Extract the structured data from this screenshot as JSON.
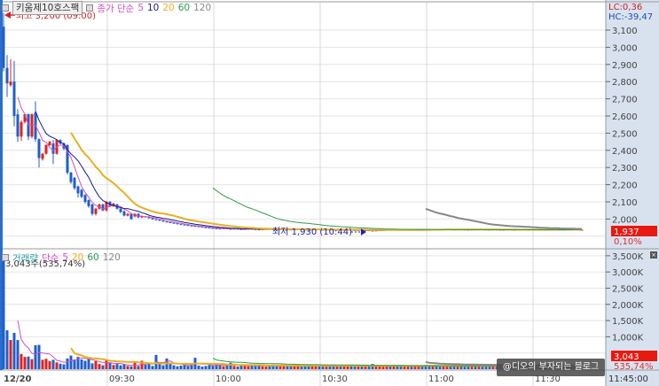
{
  "price_panel": {
    "title": "키움제10호스팩",
    "legend_prefix": "종가 단순",
    "ma_labels": [
      "5",
      "10",
      "20",
      "60",
      "120"
    ],
    "ma_colors": [
      "#d050c0",
      "#1a1a80",
      "#e8b020",
      "#2c9a4c",
      "#888888"
    ],
    "lc": "LC:0,36",
    "hc": "HC:-39,47",
    "high_note": "최고 3,200 (09:00)",
    "low_note": "최저 1,930 (10:44)",
    "last_price": "1,937",
    "last_change": "0,10%",
    "y_ticks": [
      "3,100",
      "3,000",
      "2,900",
      "2,800",
      "2,700",
      "2,600",
      "2,500",
      "2,400",
      "2,300",
      "2,200",
      "2,100",
      "2,000"
    ],
    "y_tick_values": [
      3100,
      3000,
      2900,
      2800,
      2700,
      2600,
      2500,
      2400,
      2300,
      2200,
      2100,
      2000
    ]
  },
  "volume_panel": {
    "title": "거래량",
    "legend_prefix": "단순",
    "ma_labels": [
      "5",
      "20",
      "60",
      "120"
    ],
    "ma_colors": [
      "#d050c0",
      "#e8b020",
      "#2c9a4c",
      "#888888"
    ],
    "current": "3,043주(535,74%)",
    "last_volume": "3,043",
    "last_change": "535,74%",
    "y_ticks": [
      "3,500K",
      "3,000K",
      "2,500K",
      "2,000K",
      "1,500K",
      "1,000K"
    ],
    "y_tick_values": [
      3500,
      3000,
      2500,
      2000,
      1500,
      1000
    ]
  },
  "time_axis": {
    "labels": [
      "12/20",
      "09:30",
      "10:00",
      "10:30",
      "11:00",
      "11:30"
    ],
    "label_bars": [
      0,
      30,
      60,
      90,
      120,
      150
    ],
    "current_time": "11:45:00"
  },
  "colors": {
    "up": "#e0211f",
    "down": "#1f5fc8",
    "axis_bg": "#d8e2ef",
    "last_box": "#e8190f"
  },
  "watermark": "@디오의 부자되는 블로그",
  "chart_data": {
    "type": "candlestick",
    "interval": "1 minute",
    "start_time": "09:00",
    "price_ylim": [
      1900,
      3200
    ],
    "volume_unit": "K shares",
    "volume_ylim": [
      0,
      3700
    ],
    "candles_ohlc": [
      [
        3120,
        3200,
        2860,
        2880
      ],
      [
        2880,
        2955,
        2710,
        2790
      ],
      [
        2780,
        2930,
        2770,
        2800
      ],
      [
        2800,
        2920,
        2540,
        2600
      ],
      [
        2610,
        2640,
        2450,
        2480
      ],
      [
        2480,
        2575,
        2455,
        2565
      ],
      [
        2565,
        2615,
        2555,
        2610
      ],
      [
        2610,
        2615,
        2460,
        2480
      ],
      [
        2480,
        2615,
        2470,
        2610
      ],
      [
        2620,
        2685,
        2450,
        2465
      ],
      [
        2465,
        2470,
        2300,
        2355
      ],
      [
        2350,
        2385,
        2340,
        2380
      ],
      [
        2380,
        2435,
        2375,
        2430
      ],
      [
        2430,
        2455,
        2425,
        2450
      ],
      [
        2440,
        2460,
        2320,
        2380
      ],
      [
        2380,
        2465,
        2375,
        2460
      ],
      [
        2460,
        2465,
        2435,
        2440
      ],
      [
        2440,
        2445,
        2400,
        2410
      ],
      [
        2430,
        2435,
        2260,
        2270
      ],
      [
        2270,
        2275,
        2205,
        2215
      ],
      [
        2240,
        2245,
        2170,
        2180
      ],
      [
        2190,
        2195,
        2125,
        2150
      ],
      [
        2170,
        2175,
        2120,
        2130
      ],
      [
        2140,
        2145,
        2090,
        2100
      ],
      [
        2110,
        2115,
        2065,
        2075
      ],
      [
        2085,
        2090,
        2020,
        2030
      ],
      [
        2030,
        2065,
        2020,
        2060
      ],
      [
        2060,
        2090,
        2055,
        2085
      ],
      [
        2085,
        2090,
        2045,
        2050
      ],
      [
        2050,
        2105,
        2045,
        2100
      ],
      [
        2100,
        2105,
        2070,
        2075
      ],
      [
        2075,
        2095,
        2070,
        2090
      ],
      [
        2085,
        2090,
        2055,
        2060
      ],
      [
        2060,
        2065,
        2035,
        2040
      ],
      [
        2045,
        2050,
        2015,
        2020
      ],
      [
        2020,
        2035,
        2015,
        2030
      ],
      [
        2030,
        2035,
        1995,
        2000
      ],
      [
        2015,
        2035,
        2010,
        2030
      ],
      [
        2030,
        2035,
        2005,
        2010
      ],
      [
        2010,
        2020,
        2005,
        2015
      ]
    ],
    "tail_closes": [
      2010,
      2005,
      1998,
      1995,
      1990,
      1985,
      1982,
      1978,
      1975,
      1970,
      1968,
      1965,
      1962,
      1960,
      1958,
      1955,
      1952,
      1950,
      1948,
      1946,
      1945,
      1944,
      1946,
      1943,
      1942,
      1944,
      1941,
      1940,
      1942,
      1943,
      1941,
      1940,
      1939,
      1941,
      1942,
      1940,
      1939,
      1938,
      1940,
      1941,
      1939,
      1938,
      1940,
      1941,
      1939,
      1938,
      1937,
      1939,
      1940,
      1938,
      1937,
      1939,
      1938,
      1937,
      1938,
      1936,
      1937,
      1938,
      1936,
      1935,
      1936,
      1934,
      1935,
      1933,
      1930,
      1934,
      1936,
      1937,
      1938,
      1937,
      1939,
      1938,
      1937,
      1939,
      1940,
      1938,
      1939,
      1941,
      1940,
      1939,
      1938,
      1940,
      1939,
      1938,
      1940,
      1941,
      1939,
      1938,
      1940,
      1939,
      1938,
      1937,
      1939,
      1938,
      1940,
      1939,
      1938,
      1937,
      1939,
      1938,
      1937,
      1938,
      1939,
      1937,
      1938,
      1940,
      1939,
      1937,
      1938,
      1939,
      1937,
      1938,
      1936,
      1938,
      1937,
      1939,
      1938,
      1937,
      1936,
      1938,
      1937,
      1938,
      1936,
      1937
    ],
    "volumes": [
      3390,
      1200,
      900,
      1120,
      900,
      470,
      380,
      390,
      310,
      740,
      750,
      290,
      320,
      250,
      290,
      210,
      170,
      150,
      330,
      420,
      300,
      380,
      300,
      260,
      330,
      180,
      250,
      160,
      120,
      280,
      200,
      130,
      160,
      120,
      150,
      100,
      90,
      200,
      100,
      260,
      140,
      170,
      100,
      440,
      200,
      120,
      330,
      180,
      120,
      90,
      110,
      140,
      100,
      150,
      350,
      110,
      80,
      100,
      130,
      120,
      140,
      120,
      90,
      110,
      200,
      100,
      80,
      130,
      110,
      90,
      150,
      100,
      120,
      90,
      80,
      110,
      140,
      100,
      90,
      120,
      100,
      90,
      130,
      110,
      80,
      150,
      100,
      120,
      90,
      110,
      100,
      80,
      120,
      140,
      90,
      110,
      100,
      130,
      90,
      80,
      110,
      120,
      90,
      100,
      160,
      90,
      110,
      80,
      120,
      100,
      90,
      130,
      110,
      80,
      100,
      120,
      90,
      110,
      100,
      130,
      90,
      110,
      100,
      80,
      120,
      100,
      90,
      140,
      110,
      100,
      80,
      120,
      90,
      110,
      100,
      130,
      90,
      80,
      110,
      100,
      120,
      90,
      100,
      110,
      80,
      130,
      100,
      90,
      120,
      110,
      100,
      80,
      90,
      120,
      100,
      110,
      90,
      130,
      100,
      80,
      110,
      90,
      100,
      3
    ],
    "price_ma_periods": [
      5,
      10,
      20,
      60,
      120
    ],
    "volume_ma_periods": [
      5,
      20,
      60,
      120
    ]
  }
}
